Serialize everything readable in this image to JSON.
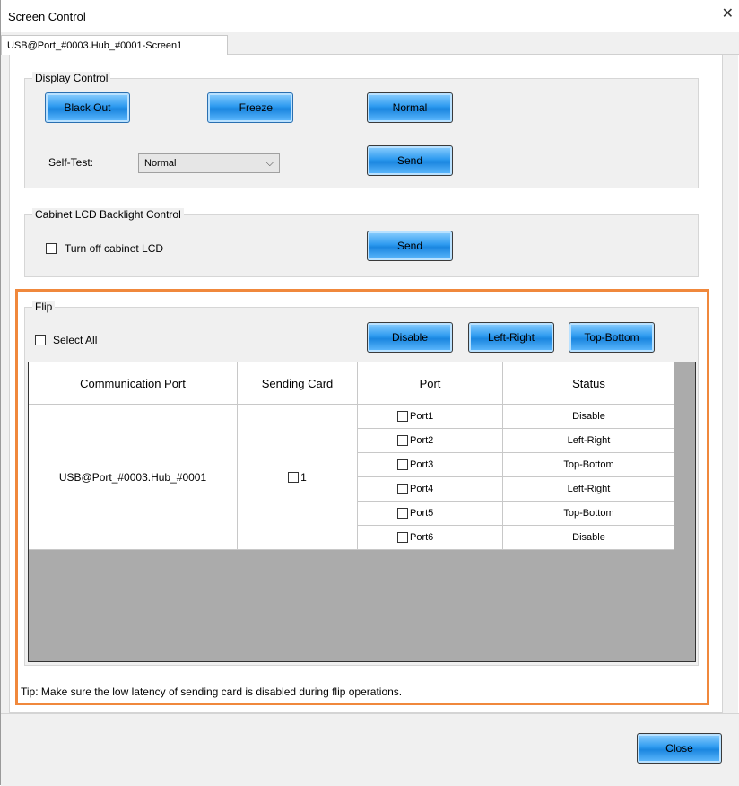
{
  "window": {
    "title": "Screen Control",
    "close_icon": "close-icon"
  },
  "tabs": [
    {
      "label": "USB@Port_#0003.Hub_#0001-Screen1"
    }
  ],
  "display_control": {
    "legend": "Display Control",
    "buttons": {
      "black_out": "Black Out",
      "freeze": "Freeze",
      "normal": "Normal",
      "send": "Send"
    },
    "self_test_label": "Self-Test:",
    "self_test_value": "Normal"
  },
  "backlight": {
    "legend": "Cabinet LCD Backlight Control",
    "checkbox_label": "Turn off cabinet LCD",
    "send": "Send"
  },
  "flip": {
    "legend": "Flip",
    "select_all": "Select All",
    "buttons": {
      "disable": "Disable",
      "left_right": "Left-Right",
      "top_bottom": "Top-Bottom"
    },
    "columns": [
      "Communication Port",
      "Sending Card",
      "Port",
      "Status"
    ],
    "communication_port": "USB@Port_#0003.Hub_#0001",
    "sending_card": "1",
    "rows": [
      {
        "port": "Port1",
        "status": "Disable"
      },
      {
        "port": "Port2",
        "status": "Left-Right"
      },
      {
        "port": "Port3",
        "status": "Top-Bottom"
      },
      {
        "port": "Port4",
        "status": "Left-Right"
      },
      {
        "port": "Port5",
        "status": "Top-Bottom"
      },
      {
        "port": "Port6",
        "status": "Disable"
      }
    ],
    "tip": "Tip: Make sure the low latency of sending card is disabled during flip operations."
  },
  "footer": {
    "close": "Close"
  },
  "colors": {
    "highlight_border": "#f0883c",
    "button_blue": "#1a86e0",
    "grid_background": "#ababab"
  }
}
